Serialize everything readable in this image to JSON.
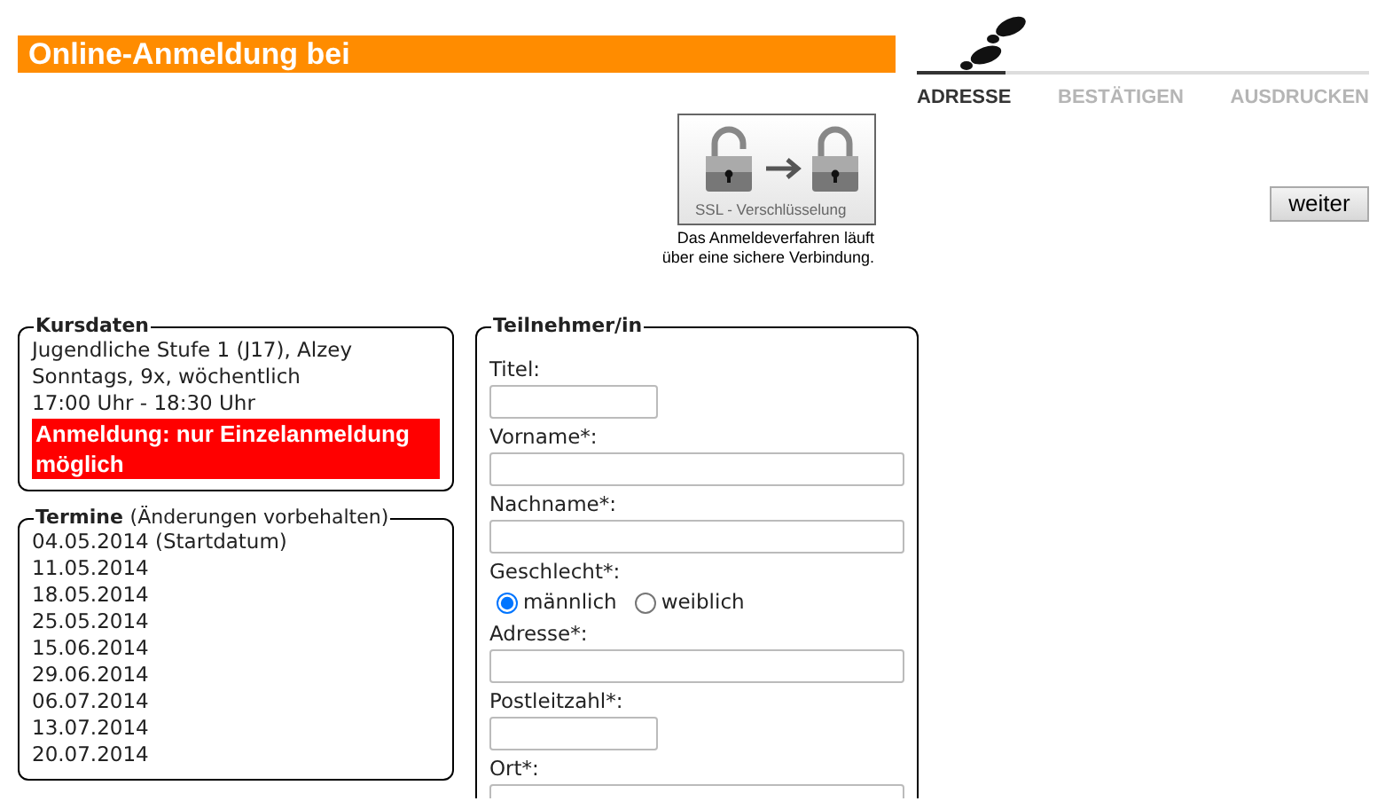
{
  "header": {
    "title": "Online-Anmeldung bei"
  },
  "steps": [
    {
      "label": "ADRESSE",
      "selected": true
    },
    {
      "label": "BESTÄTIGEN",
      "selected": false
    },
    {
      "label": "AUSDRUCKEN",
      "selected": false
    }
  ],
  "ssl": {
    "badge_text": "SSL - Verschlüsselung",
    "note": [
      "Das Anmeldeverfahren läuft",
      "über eine sichere Verbindung."
    ]
  },
  "buttons": [
    "weiter"
  ],
  "kursdaten": {
    "legend": "Kursdaten",
    "lines": [
      "Jugendliche Stufe 1 (J17), Alzey",
      "Sonntags, 9x, wöchentlich",
      "17:00 Uhr - 18:30 Uhr"
    ],
    "notice": "Anmeldung: nur Einzelanmeldung möglich"
  },
  "termine": {
    "legend": "Termine",
    "legend_note": "(Änderungen vorbehalten)",
    "dates": [
      "04.05.2014 (Startdatum)",
      "11.05.2014",
      "18.05.2014",
      "25.05.2014",
      "15.06.2014",
      "29.06.2014",
      "06.07.2014",
      "13.07.2014",
      "20.07.2014"
    ]
  },
  "teilnehmer": {
    "legend": "Teilnehmer/in",
    "fields": [
      {
        "label": "Titel:",
        "kind": "short-text"
      },
      {
        "label": "Vorname*:",
        "kind": "text"
      },
      {
        "label": "Nachname*:",
        "kind": "text"
      },
      {
        "label": "Geschlecht*:",
        "kind": "radio",
        "options": [
          {
            "label": "männlich",
            "selected": true
          },
          {
            "label": "weiblich",
            "selected": false
          }
        ]
      },
      {
        "label": "Adresse*:",
        "kind": "text"
      },
      {
        "label": "Postleitzahl*:",
        "kind": "short-text"
      },
      {
        "label": "Ort*:",
        "kind": "text"
      }
    ]
  }
}
